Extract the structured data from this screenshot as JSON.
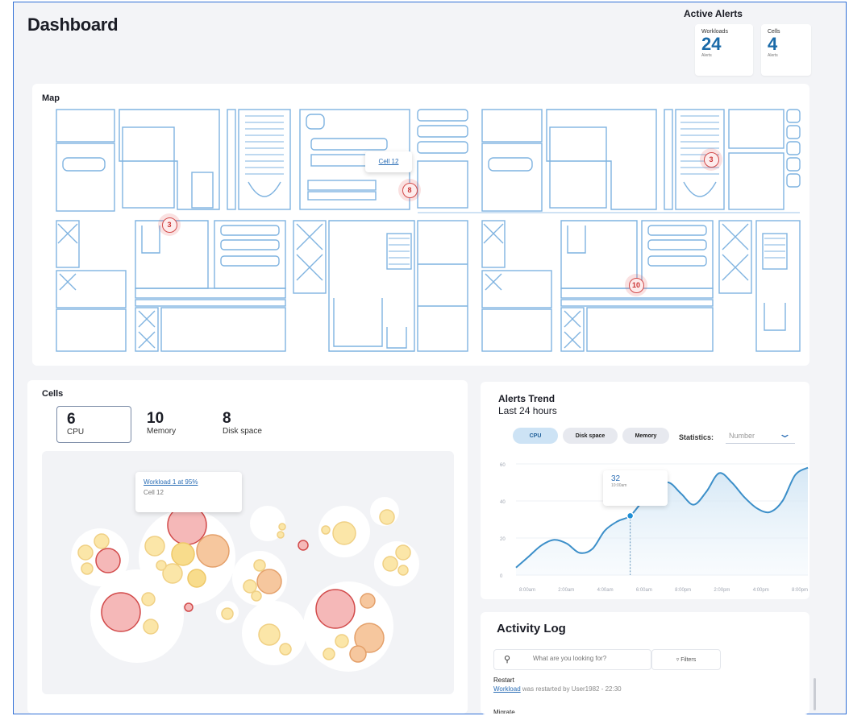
{
  "header": {
    "title": "Dashboard"
  },
  "active_alerts": {
    "title": "Active Alerts",
    "cards": [
      {
        "label": "Workloads",
        "count": "24",
        "sub": "Alerts"
      },
      {
        "label": "Cells",
        "count": "4",
        "sub": "Alerts"
      }
    ]
  },
  "map": {
    "title": "Map",
    "tooltip": "Cell 12",
    "pins": [
      "3",
      "8",
      "3",
      "10"
    ]
  },
  "cells": {
    "title": "Cells",
    "stats": [
      {
        "value": "6",
        "label": "CPU"
      },
      {
        "value": "10",
        "label": "Memory"
      },
      {
        "value": "8",
        "label": "Disk space"
      }
    ],
    "tooltip": {
      "title": "Workload 1 at 95%",
      "sub": "Cell 12"
    }
  },
  "alerts_trend": {
    "title": "Alerts Trend",
    "subtitle": "Last 24 hours",
    "tabs": [
      "CPU",
      "Disk space",
      "Memory"
    ],
    "statistics_label": "Statistics:",
    "statistics_value": "Number",
    "tooltip": {
      "value": "32",
      "time": "10:00am"
    }
  },
  "chart_data": {
    "type": "area",
    "y_ticks": [
      "60",
      "40",
      "20",
      "0"
    ],
    "x_ticks": [
      "8:00am",
      "2:00am",
      "4:00am",
      "6:00am",
      "8:00pm",
      "2:00pm",
      "4:00pm",
      "8:00pm"
    ],
    "ylim": [
      0,
      60
    ],
    "series": [
      {
        "values": [
          4,
          10,
          16,
          19,
          17,
          12,
          14,
          24,
          29,
          32,
          40,
          46,
          50,
          44,
          38,
          45,
          55,
          50,
          42,
          36,
          34,
          40,
          54,
          58
        ]
      }
    ],
    "highlight_index": 9,
    "colors": {
      "line": "#3c8fc9",
      "fill": "#d7e9f6"
    }
  },
  "activity_log": {
    "title": "Activity Log",
    "search_placeholder": "What are you looking for?",
    "filters_label": "Filters",
    "entries": [
      {
        "title": "Restart",
        "link": "Workload",
        "text": " was restarted by User1982 - 22:30"
      }
    ],
    "next_title": "Migrate"
  },
  "icons": {
    "search": "search-icon",
    "filter": "filter-icon",
    "chevron": "chevron-down-icon"
  }
}
